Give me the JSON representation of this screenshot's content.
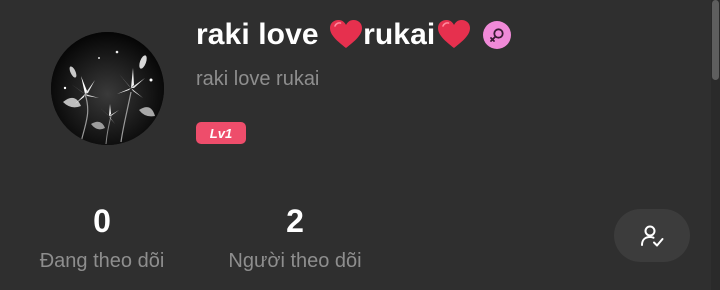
{
  "profile": {
    "name_part1": "raki love ",
    "name_part2": "rukai",
    "username": "raki love rukai",
    "level": "Lv1",
    "gender_icon": "female-icon"
  },
  "stats": {
    "following": {
      "count": "0",
      "label": "Đang theo dõi"
    },
    "followers": {
      "count": "2",
      "label": "Người theo dõi"
    }
  },
  "actions": {
    "follow_icon": "user-check-icon"
  },
  "colors": {
    "background": "#2f2f2f",
    "heart": "#e6304e",
    "gender_badge": "#f08ad8",
    "level_badge": "#ee4d6b",
    "muted_text": "#8e8e8e"
  }
}
